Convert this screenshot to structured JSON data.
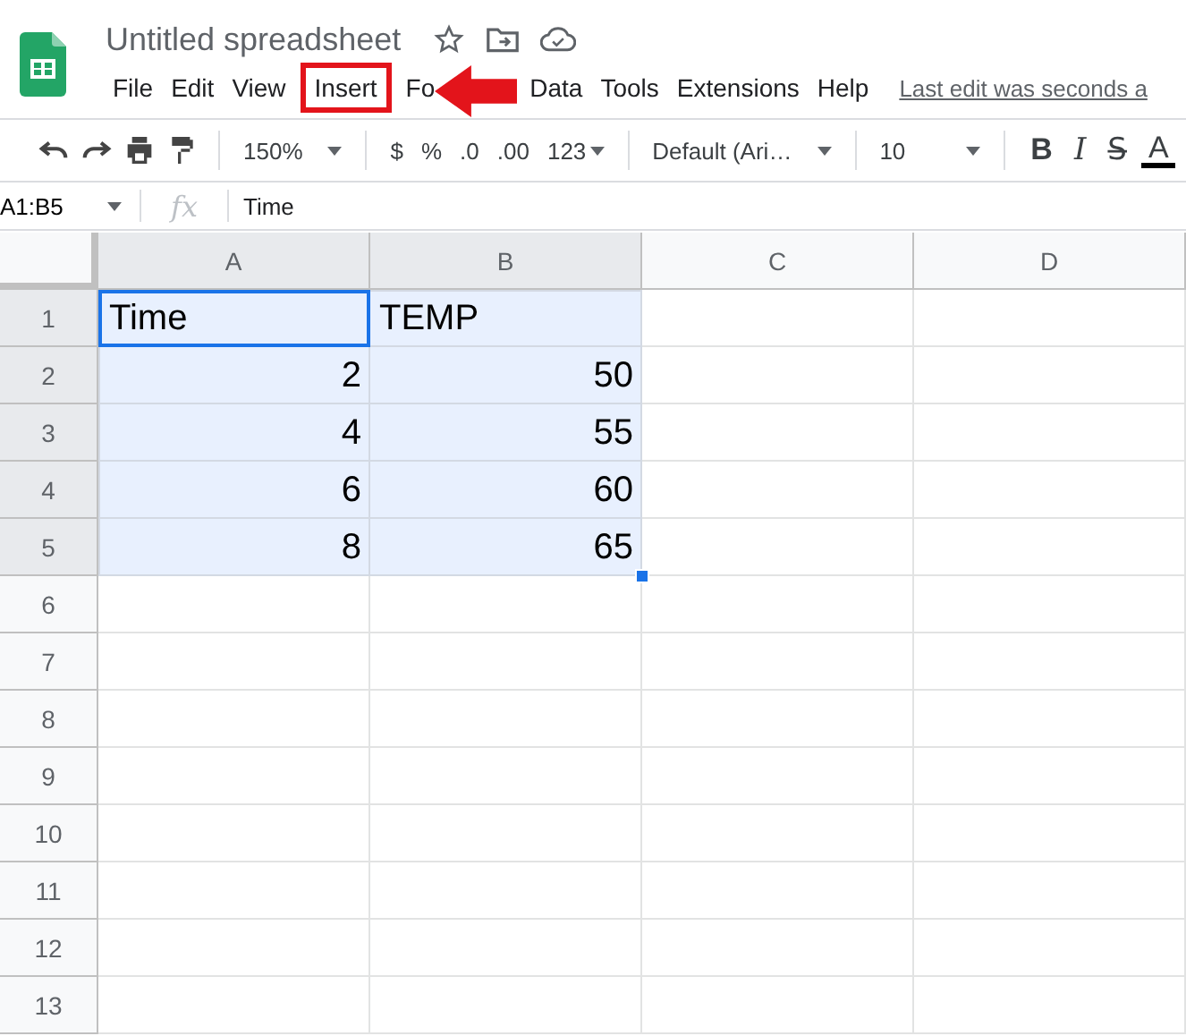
{
  "document": {
    "title": "Untitled spreadsheet"
  },
  "menu": [
    {
      "label": "File",
      "annotated": false
    },
    {
      "label": "Edit",
      "annotated": false
    },
    {
      "label": "View",
      "annotated": false
    },
    {
      "label": "Insert",
      "annotated": true
    },
    {
      "label": "Fo",
      "annotated": false
    },
    {
      "label": "Data",
      "annotated": false
    },
    {
      "label": "Tools",
      "annotated": false
    },
    {
      "label": "Extensions",
      "annotated": false
    },
    {
      "label": "Help",
      "annotated": false
    }
  ],
  "last_edit": "Last edit was seconds a",
  "toolbar": {
    "zoom": "150%",
    "currency": "$",
    "percent": "%",
    "decrease_decimals": ".0",
    "increase_decimals": ".00",
    "number_format": "123",
    "font": "Default (Ari…",
    "font_size": "10",
    "bold": "B",
    "italic": "I",
    "strikethrough": "S̶",
    "text_color": "A"
  },
  "formula_bar": {
    "name_box": "A1:B5",
    "fx": "fx",
    "value": "Time"
  },
  "grid": {
    "columns": [
      {
        "label": "A",
        "selected": true
      },
      {
        "label": "B",
        "selected": true
      },
      {
        "label": "C",
        "selected": false
      },
      {
        "label": "D",
        "selected": false
      }
    ],
    "rows": [
      {
        "label": "1",
        "selected": true,
        "cells": [
          {
            "text": "Time",
            "kind": "text",
            "selected": true,
            "active": true
          },
          {
            "text": "TEMP",
            "kind": "text",
            "selected": true,
            "active": false
          }
        ]
      },
      {
        "label": "2",
        "selected": true,
        "cells": [
          {
            "text": "2",
            "kind": "number",
            "selected": true,
            "active": false
          },
          {
            "text": "50",
            "kind": "number",
            "selected": true,
            "active": false
          }
        ]
      },
      {
        "label": "3",
        "selected": true,
        "cells": [
          {
            "text": "4",
            "kind": "number",
            "selected": true,
            "active": false
          },
          {
            "text": "55",
            "kind": "number",
            "selected": true,
            "active": false
          }
        ]
      },
      {
        "label": "4",
        "selected": true,
        "cells": [
          {
            "text": "6",
            "kind": "number",
            "selected": true,
            "active": false
          },
          {
            "text": "60",
            "kind": "number",
            "selected": true,
            "active": false
          }
        ]
      },
      {
        "label": "5",
        "selected": true,
        "cells": [
          {
            "text": "8",
            "kind": "number",
            "selected": true,
            "active": false
          },
          {
            "text": "65",
            "kind": "number",
            "selected": true,
            "active": false
          }
        ]
      },
      {
        "label": "6",
        "selected": false
      },
      {
        "label": "7",
        "selected": false
      },
      {
        "label": "8",
        "selected": false
      },
      {
        "label": "9",
        "selected": false
      },
      {
        "label": "10",
        "selected": false
      },
      {
        "label": "11",
        "selected": false
      },
      {
        "label": "12",
        "selected": false
      },
      {
        "label": "13",
        "selected": false
      }
    ]
  }
}
